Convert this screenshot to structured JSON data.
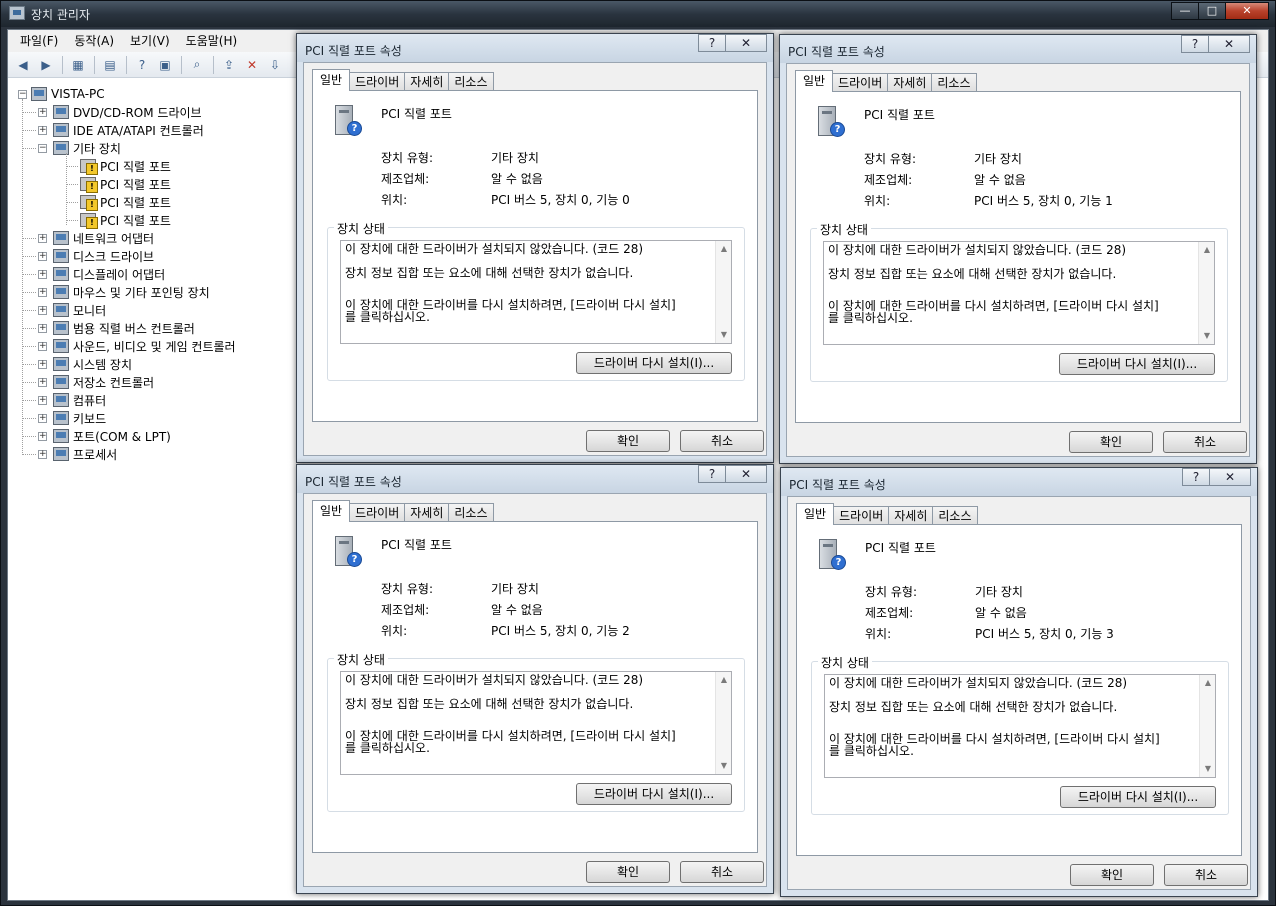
{
  "window": {
    "title": "장치 관리자",
    "caption_min": "—",
    "caption_max": "□",
    "caption_close": "✕"
  },
  "menu": [
    "파일(F)",
    "동작(A)",
    "보기(V)",
    "도움말(H)"
  ],
  "toolbar_icons": [
    "back-arrow-icon",
    "forward-arrow-icon",
    "tree-view-icon",
    "properties-icon",
    "help-icon",
    "console-icon",
    "scan-hardware-icon",
    "update-driver-icon",
    "uninstall-icon",
    "disable-icon"
  ],
  "tree": {
    "root": "VISTA-PC",
    "categories": [
      {
        "label": "DVD/CD-ROM 드라이브",
        "expander": "+"
      },
      {
        "label": "IDE ATA/ATAPI 컨트롤러",
        "expander": "+"
      },
      {
        "label": "기타 장치",
        "expander": "−"
      },
      {
        "label": "PCI 직렬 포트",
        "child": true
      },
      {
        "label": "PCI 직렬 포트",
        "child": true
      },
      {
        "label": "PCI 직렬 포트",
        "child": true
      },
      {
        "label": "PCI 직렬 포트",
        "child": true
      },
      {
        "label": "네트워크 어댑터",
        "expander": "+"
      },
      {
        "label": "디스크 드라이브",
        "expander": "+"
      },
      {
        "label": "디스플레이 어댑터",
        "expander": "+"
      },
      {
        "label": "마우스 및 기타 포인팅 장치",
        "expander": "+"
      },
      {
        "label": "모니터",
        "expander": "+"
      },
      {
        "label": "범용 직렬 버스 컨트롤러",
        "expander": "+"
      },
      {
        "label": "사운드, 비디오 및 게임 컨트롤러",
        "expander": "+"
      },
      {
        "label": "시스템 장치",
        "expander": "+"
      },
      {
        "label": "저장소 컨트롤러",
        "expander": "+"
      },
      {
        "label": "컴퓨터",
        "expander": "+"
      },
      {
        "label": "키보드",
        "expander": "+"
      },
      {
        "label": "포트(COM & LPT)",
        "expander": "+"
      },
      {
        "label": "프로세서",
        "expander": "+"
      }
    ]
  },
  "dialog_common": {
    "title": "PCI 직렬 포트 속성",
    "help": "?",
    "close": "✕",
    "tabs": [
      "일반",
      "드라이버",
      "자세히",
      "리소스"
    ],
    "device_name": "PCI 직렬 포트",
    "type_label": "장치 유형:",
    "type_value": "기타 장치",
    "mfr_label": "제조업체:",
    "mfr_value": "알 수 없음",
    "loc_label": "위치:",
    "status_group": "장치 상태",
    "status_line1": "이 장치에 대한 드라이버가 설치되지 않았습니다. (코드 28)",
    "status_line2": "장치 정보 집합 또는 요소에 대해 선택한 장치가 없습니다.",
    "status_line3": "이 장치에 대한 드라이버를 다시 설치하려면, [드라이버 다시 설치]",
    "status_line4": "를 클릭하십시오.",
    "reinstall_button": "드라이버 다시 설치(I)...",
    "ok_button": "확인",
    "cancel_button": "취소"
  },
  "dialogs": [
    {
      "location": "PCI 버스 5, 장치 0, 기능 0"
    },
    {
      "location": "PCI 버스 5, 장치 0, 기능 1"
    },
    {
      "location": "PCI 버스 5, 장치 0, 기능 2"
    },
    {
      "location": "PCI 버스 5, 장치 0, 기능 3"
    }
  ]
}
